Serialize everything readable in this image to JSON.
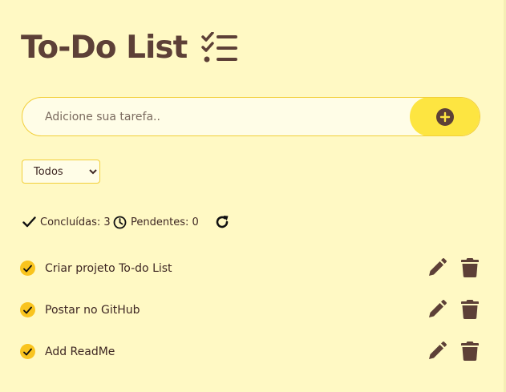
{
  "header": {
    "title": "To-Do List",
    "icon": "task-list-icon"
  },
  "form": {
    "placeholder": "Adicione sua tarefa..",
    "add_icon": "plus-circle-icon"
  },
  "filter": {
    "selected": "Todos"
  },
  "stats": {
    "completed_label": "Concluídas: 3",
    "pending_label": "Pendentes: 0",
    "reset_icon": "rotate-icon"
  },
  "tasks": [
    {
      "text": "Criar projeto To-do List",
      "done": true
    },
    {
      "text": "Postar no GitHub",
      "done": true
    },
    {
      "text": "Add ReadMe",
      "done": true
    }
  ],
  "colors": {
    "background": "#fff9c4",
    "accent": "#fde541",
    "brown": "#5d4037",
    "check": "#f9c41f"
  }
}
